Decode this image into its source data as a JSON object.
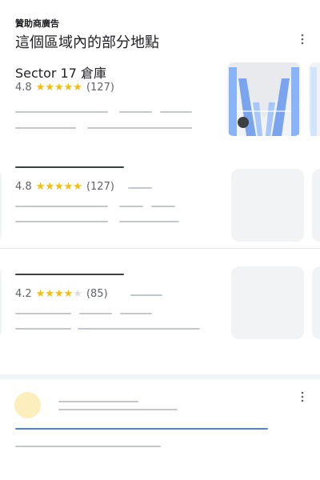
{
  "sponsored": {
    "label": "贊助商廣告",
    "title": "這個區域內的部分地點"
  },
  "places": [
    {
      "name": "Sector 17 倉庫",
      "rating": "4.8",
      "stars_full": 5,
      "count": "(127)"
    },
    {
      "name": "",
      "rating": "4.8",
      "stars_full": 5,
      "count": "(127)"
    },
    {
      "name": "",
      "rating": "4.2",
      "stars_full": 4,
      "count": "(85)"
    }
  ],
  "icons": {
    "more": "more-vert-icon",
    "star": "star-icon"
  },
  "colors": {
    "star": "#fbbc04",
    "accent": "#4a86e8",
    "placeholder": "#f1f3f4"
  }
}
